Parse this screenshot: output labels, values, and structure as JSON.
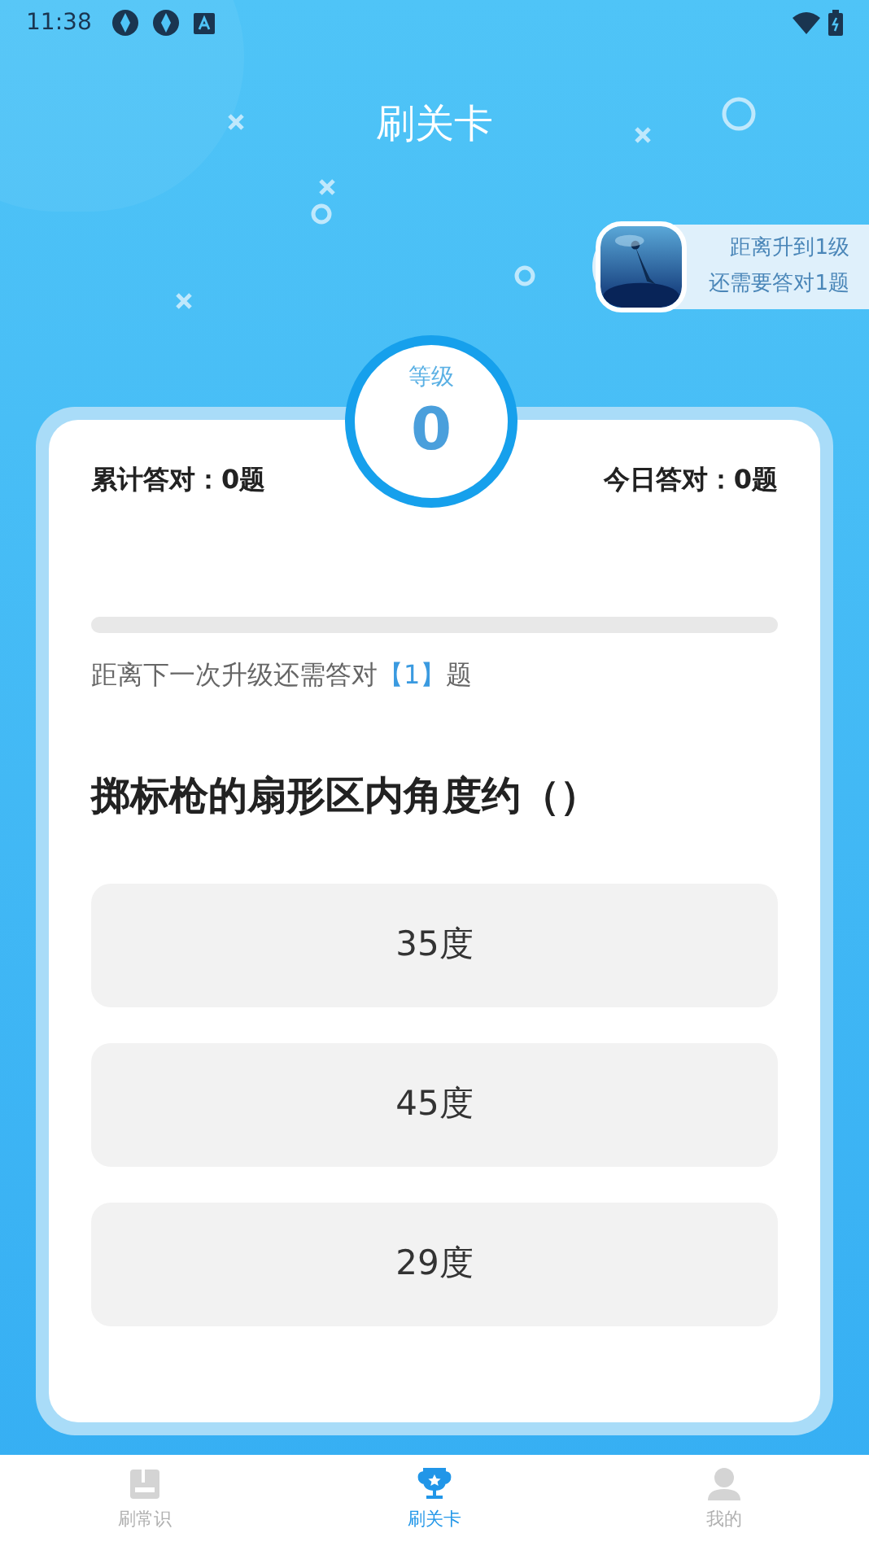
{
  "status_bar": {
    "time": "11:38"
  },
  "header": {
    "title": "刷关卡"
  },
  "upgrade_badge": {
    "line_1": "距离升到1级",
    "line_2": "还需要答对1题"
  },
  "level": {
    "label": "等级",
    "value": "0"
  },
  "stats": {
    "total": "累计答对：0题",
    "today": "今日答对：0题"
  },
  "progress": {
    "level": 0,
    "hint_before": "距离下一次升级还需答对",
    "hint_count": "【1】",
    "hint_after": "题"
  },
  "question": {
    "text": "掷标枪的扇形区内角度约（）",
    "options": [
      {
        "label": "35度"
      },
      {
        "label": "45度"
      },
      {
        "label": "29度"
      }
    ]
  },
  "tab_bar": [
    {
      "label": "刷常识",
      "kind": "book",
      "selected": false
    },
    {
      "label": "刷关卡",
      "kind": "trophy",
      "selected": true
    },
    {
      "label": "我的",
      "kind": "person",
      "selected": false
    }
  ]
}
